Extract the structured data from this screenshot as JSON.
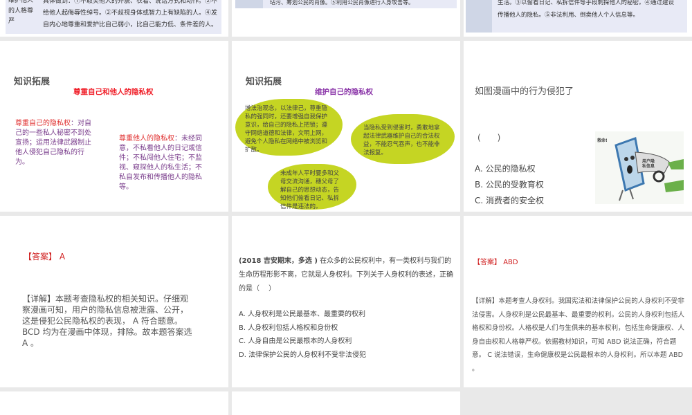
{
  "slide1": {
    "label": "维护他人的人格尊严",
    "text": "具体做到：①不取笑他人的外貌、衣着、说话方式和动作。②不给他人起侮辱性绰号。③不歧视身体或智力上有缺陷的人。④发自内心地尊重和爱护比自己弱小，比自己能力低、条件差的人。"
  },
  "slide2": {
    "text": "玷污、筹划公民的肖像。⑤利用公民肖像进行人身攻击等。"
  },
  "slide3": {
    "line1": "生活。③以偷看日记、私拆信件等手段刺探他人的秘密。④通过建设",
    "line2": "传播他人的隐私。⑤非法利用、倒卖他人个人信息等。"
  },
  "slide4": {
    "heading": "知识拓展",
    "title": "尊重自己和他人的隐私权",
    "left_label": "尊重自己的隐私权",
    "left_text": "：对自己的一些私人秘密不到处宣扬；运用法律武器制止他人侵犯自己隐私的行为。",
    "right_label": "尊重他人的隐私权",
    "right_text": "：未经同意，不私看他人的日记或信件；不私闯他人住宅；不监视、窥探他人的私生活；不私自发布和传播他人的隐私等。"
  },
  "slide5": {
    "heading": "知识拓展",
    "title": "维护自己的隐私权",
    "blob1": "增法治观念，以法律己，尊重隐私的强同时，还要增强自我保护意识，给自己的隐私上把锁；遵守网络道德和法律，文明上网，避免个人隐私在网络中被浏览和扩散。",
    "blob2": "当隐私受到侵害时，勇敢地拿起法律武器维护自己的合法权益，不能忍气吞声，也不能非法报复。",
    "blob3": "未成年人平时要多和父母交流沟通，穗父母了解自己的思想动态，告知他们偷看日记、私拆信件是违法的。"
  },
  "slide6": {
    "question": "如图漫画中的行为侵犯了",
    "blank": "(　　)",
    "options": [
      "A. 公民的隐私权",
      "B. 公民的受教育权",
      "C. 消费者的安全权"
    ],
    "cartoon_shout": "救命!",
    "cartoon_label": "用户隐私信息"
  },
  "slide7": {
    "answer_label": "【答案】",
    "answer": "A",
    "detail": "【详解】本题考查隐私权的相关知识。仔细观察漫画可知，用户的隐私信息被泄露、公开，这是侵犯公民隐私权的表现， A 符合题意。 BCD 均为在漫画中体现，排除。故本题答案选 A 。"
  },
  "slide8": {
    "source": "(2018 吉安期末，多选 )",
    "question": " 在众多的公民权利中，有一类权利与我们的生命历程形影不离，它就是人身权利。下列关于人身权利的表述，正确的是（　 ）",
    "options": [
      "A. 人身权利是公民最基本、最重要的权利",
      "B. 人身权利包括人格权和身份权",
      "C. 人身自由是公民最根本的人身权利",
      "D. 法律保护公民的人身权利不受非法侵犯"
    ]
  },
  "slide9": {
    "answer_label": "【答案】",
    "answer": "ABD",
    "detail": "【详解】本题考查人身权利。我国宪法和法律保护公民的人身权利不受非法侵害。人身权利是公民最基本、最重要的权利。公民的人身权利包括人格权和身份权。人格权是人们与生俱来的基本权利，包括生命健康权、人身自由权和人格尊严权。依据教材知识，可知 ABD 说法正确，符合题意。 C 说法错误，生命健康权是公民最根本的人身权利。所以本题 ABD 。"
  }
}
